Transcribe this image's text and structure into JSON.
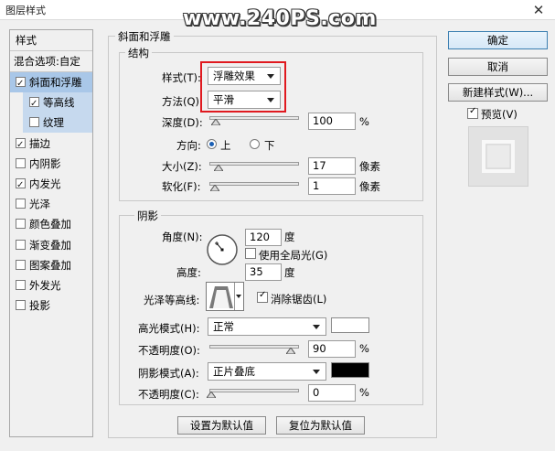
{
  "window": {
    "title": "图层样式",
    "watermark": "www.240PS.com"
  },
  "styles_panel": {
    "header": "样式",
    "blend_options": "混合选项:自定",
    "items": [
      {
        "label": "斜面和浮雕",
        "checked": true
      },
      {
        "label": "等高线",
        "checked": true
      },
      {
        "label": "纹理",
        "checked": false
      },
      {
        "label": "描边",
        "checked": true
      },
      {
        "label": "内阴影",
        "checked": false
      },
      {
        "label": "内发光",
        "checked": true
      },
      {
        "label": "光泽",
        "checked": false
      },
      {
        "label": "颜色叠加",
        "checked": false
      },
      {
        "label": "渐变叠加",
        "checked": false
      },
      {
        "label": "图案叠加",
        "checked": false
      },
      {
        "label": "外发光",
        "checked": false
      },
      {
        "label": "投影",
        "checked": false
      }
    ]
  },
  "bevel": {
    "title": "斜面和浮雕",
    "structure": {
      "title": "结构",
      "style_label": "样式(T):",
      "style_value": "浮雕效果",
      "technique_label": "方法(Q):",
      "technique_value": "平滑",
      "depth_label": "深度(D):",
      "depth_value": "100",
      "depth_unit": "%",
      "depth_level_pct": 0,
      "direction_label": "方向:",
      "direction_up": "上",
      "direction_down": "下",
      "size_label": "大小(Z):",
      "size_value": "17",
      "size_unit": "像素",
      "soften_label": "软化(F):",
      "soften_value": "1",
      "soften_unit": "像素"
    },
    "shading": {
      "title": "阴影",
      "angle_label": "角度(N):",
      "angle_value": "120",
      "angle_unit": "度",
      "global_light_label": "使用全局光(G)",
      "global_light_checked": false,
      "altitude_label": "高度:",
      "altitude_value": "35",
      "altitude_unit": "度",
      "gloss_contour_label": "光泽等高线:",
      "anti_alias_label": "消除锯齿(L)",
      "anti_alias_checked": true,
      "highlight_mode_label": "高光模式(H):",
      "highlight_mode_value": "正常",
      "highlight_color": "#ffffff",
      "highlight_opacity_label": "不透明度(O):",
      "highlight_opacity_value": "90",
      "highlight_opacity_unit": "%",
      "shadow_mode_label": "阴影模式(A):",
      "shadow_mode_value": "正片叠底",
      "shadow_color": "#000000",
      "shadow_opacity_label": "不透明度(C):",
      "shadow_opacity_value": "0",
      "shadow_opacity_unit": "%"
    },
    "make_default": "设置为默认值",
    "reset_default": "复位为默认值"
  },
  "actions": {
    "ok": "确定",
    "cancel": "取消",
    "new_style": "新建样式(W)...",
    "preview_label": "预览(V)",
    "preview_checked": true
  },
  "colors": {
    "highlight_red": "#e0191f",
    "selection": "#a9c7e8"
  }
}
